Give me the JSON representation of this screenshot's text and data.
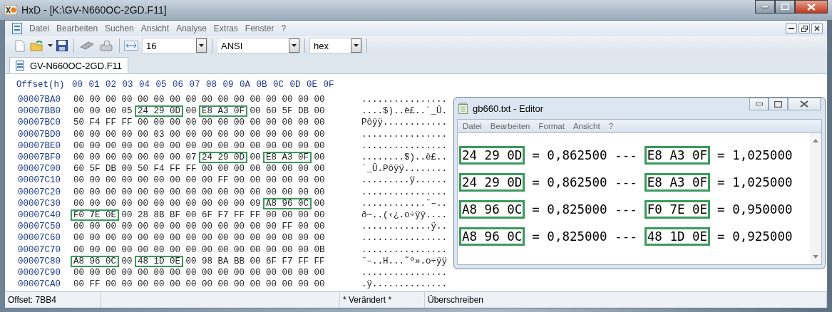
{
  "window": {
    "title": "HxD - [K:\\GV-N660OC-2GD.F11]"
  },
  "menu": [
    "Datei",
    "Bearbeiten",
    "Suchen",
    "Ansicht",
    "Analyse",
    "Extras",
    "Fenster",
    "?"
  ],
  "toolbar": {
    "combos": [
      {
        "kind": "width",
        "value": "16"
      },
      {
        "kind": "plain",
        "value": "ANSI"
      },
      {
        "kind": "plain",
        "value": "hex"
      }
    ]
  },
  "tabs": [
    {
      "label": "GV-N660OC-2GD.F11",
      "selected": true
    }
  ],
  "hex_view": {
    "header_offset": "Offset(h)",
    "header_columns": [
      "00",
      "01",
      "02",
      "03",
      "04",
      "05",
      "06",
      "07",
      "08",
      "09",
      "0A",
      "0B",
      "0C",
      "0D",
      "0E",
      "0F"
    ],
    "rows": [
      {
        "offset": "00007BA0",
        "segments": [
          {
            "bytes": "00 00 00 00 00 00 00 00 00 00 00 00 00 00 00 00",
            "boxed": false
          }
        ],
        "ascii": "................"
      },
      {
        "offset": "00007BB0",
        "segments": [
          {
            "bytes": "00 00 00 05",
            "boxed": false
          },
          {
            "bytes": "24 29 0D",
            "boxed": true
          },
          {
            "bytes": "00",
            "boxed": false
          },
          {
            "bytes": "E8 A3 0F",
            "boxed": true
          },
          {
            "bytes": "00 60 5F DB 00",
            "boxed": false
          }
        ],
        "ascii": "....$)..è£..`_Û."
      },
      {
        "offset": "00007BC0",
        "segments": [
          {
            "bytes": "50 F4 FF FF 00 00 00 00 00 00 00 00 00 00 00 00",
            "boxed": false
          }
        ],
        "ascii": "Pôÿÿ............"
      },
      {
        "offset": "00007BD0",
        "segments": [
          {
            "bytes": "00 00 00 00 00 03 00 00 00 00 00 00 00 00 00 00",
            "boxed": false
          }
        ],
        "ascii": "................"
      },
      {
        "offset": "00007BE0",
        "segments": [
          {
            "bytes": "00 00 00 00 00 00 00 00 00 00 00 00 00 00 00 00",
            "boxed": false
          }
        ],
        "ascii": "................"
      },
      {
        "offset": "00007BF0",
        "segments": [
          {
            "bytes": "00 00 00 00 00 00 00 07",
            "boxed": false
          },
          {
            "bytes": "24 29 0D",
            "boxed": true
          },
          {
            "bytes": "00",
            "boxed": false
          },
          {
            "bytes": "E8 A3 0F",
            "boxed": true
          },
          {
            "bytes": "00",
            "boxed": false
          }
        ],
        "ascii": "........$)..è£.."
      },
      {
        "offset": "00007C00",
        "segments": [
          {
            "bytes": "60 5F DB 00 50 F4 FF FF 00 00 00 00 00 00 00 00",
            "boxed": false
          }
        ],
        "ascii": "`_Û.Pôÿÿ........"
      },
      {
        "offset": "00007C10",
        "segments": [
          {
            "bytes": "00 00 00 00 00 00 00 00 00 FF 00 00 00 00 00 00",
            "boxed": false
          }
        ],
        "ascii": ".........ÿ......"
      },
      {
        "offset": "00007C20",
        "segments": [
          {
            "bytes": "00 00 00 00 00 00 00 00 00 00 00 00 00 00 00 00",
            "boxed": false
          }
        ],
        "ascii": "................"
      },
      {
        "offset": "00007C30",
        "segments": [
          {
            "bytes": "00 00 00 00 00 00 00 00 00 00 00 09",
            "boxed": false
          },
          {
            "bytes": "A8 96 0C",
            "boxed": true
          },
          {
            "bytes": "00",
            "boxed": false
          }
        ],
        "ascii": "............¨–.."
      },
      {
        "offset": "00007C40",
        "segments": [
          {
            "bytes": "F0 7E 0E",
            "boxed": true
          },
          {
            "bytes": "00 28 8B BF 00 6F F7 FF FF 00 00 00 00",
            "boxed": false
          }
        ],
        "ascii": "ð~..(‹¿.o÷ÿÿ...."
      },
      {
        "offset": "00007C50",
        "segments": [
          {
            "bytes": "00 00 00 00 00 00 00 00 00 00 00 00 00 FF 00 00",
            "boxed": false
          }
        ],
        "ascii": ".............ÿ.."
      },
      {
        "offset": "00007C60",
        "segments": [
          {
            "bytes": "00 00 00 00 00 00 00 00 00 00 00 00 00 00 00 00",
            "boxed": false
          }
        ],
        "ascii": "................"
      },
      {
        "offset": "00007C70",
        "segments": [
          {
            "bytes": "00 00 00 00 00 00 00 00 00 00 00 00 00 00 00 0B",
            "boxed": false
          }
        ],
        "ascii": "................"
      },
      {
        "offset": "00007C80",
        "segments": [
          {
            "bytes": "A8 96 0C",
            "boxed": true
          },
          {
            "bytes": "00",
            "boxed": false
          },
          {
            "bytes": "48 1D 0E",
            "boxed": true
          },
          {
            "bytes": "00 98 BA BB 00 6F F7 FF FF",
            "boxed": false
          }
        ],
        "ascii": "¨–..H...˜º».o÷ÿÿ"
      },
      {
        "offset": "00007C90",
        "segments": [
          {
            "bytes": "00 00 00 00 00 00 00 00 00 00 00 00 00 00 00 00",
            "boxed": false
          }
        ],
        "ascii": "................"
      },
      {
        "offset": "00007CA0",
        "segments": [
          {
            "bytes": "00 FF 00 00 00 00 00 00 00 00 00 00 00 00 00 00",
            "boxed": false
          }
        ],
        "ascii": ".ÿ.............."
      }
    ]
  },
  "status_bar": [
    "Offset: 7BB4",
    "* Verändert *",
    "Überschreiben"
  ],
  "editor": {
    "title": "gb660.txt - Editor",
    "menu": [
      "Datei",
      "Bearbeiten",
      "Format",
      "Ansicht",
      "?"
    ],
    "lines": [
      [
        {
          "text": "24 29 0D",
          "boxed": true
        },
        {
          "text": "= 0,862500 ---",
          "boxed": false
        },
        {
          "text": "E8 A3 0F",
          "boxed": true
        },
        {
          "text": "= 1,025000",
          "boxed": false
        }
      ],
      [
        {
          "text": "24 29 0D",
          "boxed": true
        },
        {
          "text": "= 0,862500 ---",
          "boxed": false
        },
        {
          "text": "E8 A3 0F",
          "boxed": true
        },
        {
          "text": "= 1,025000",
          "boxed": false
        }
      ],
      [
        {
          "text": "A8 96 0C",
          "boxed": true
        },
        {
          "text": "= 0,825000 ---",
          "boxed": false
        },
        {
          "text": "F0 7E 0E",
          "boxed": true
        },
        {
          "text": "= 0,950000",
          "boxed": false
        }
      ],
      [
        {
          "text": "A8 96 0C",
          "boxed": true
        },
        {
          "text": "= 0,825000 ---",
          "boxed": false
        },
        {
          "text": "48 1D 0E",
          "boxed": true
        },
        {
          "text": "= 0,925000",
          "boxed": false
        }
      ]
    ]
  }
}
